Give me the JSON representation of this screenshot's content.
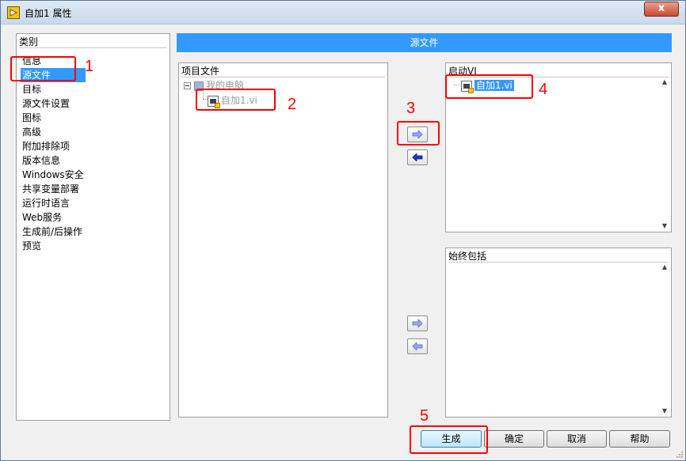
{
  "window": {
    "title": "自加1 属性",
    "close_glyph": "x"
  },
  "sidebar": {
    "header": "类别",
    "items": [
      {
        "label": "信息",
        "selected": false
      },
      {
        "label": "源文件",
        "selected": true
      },
      {
        "label": "目标",
        "selected": false
      },
      {
        "label": "源文件设置",
        "selected": false
      },
      {
        "label": "图标",
        "selected": false
      },
      {
        "label": "高级",
        "selected": false
      },
      {
        "label": "附加排除项",
        "selected": false
      },
      {
        "label": "版本信息",
        "selected": false
      },
      {
        "label": "Windows安全",
        "selected": false
      },
      {
        "label": "共享变量部署",
        "selected": false
      },
      {
        "label": "运行时语言",
        "selected": false
      },
      {
        "label": "Web服务",
        "selected": false
      },
      {
        "label": "生成前/后操作",
        "selected": false
      },
      {
        "label": "预览",
        "selected": false
      }
    ]
  },
  "section_title": "源文件",
  "project_files": {
    "header": "项目文件",
    "root_label": "我的电脑",
    "child_label": "自加1.vi"
  },
  "startup_vi": {
    "header": "启动VI",
    "item_label": "自加1.vi"
  },
  "always_include": {
    "header": "始终包括"
  },
  "buttons": {
    "build": "生成",
    "ok": "确定",
    "cancel": "取消",
    "help": "帮助"
  },
  "annotations": [
    "1",
    "2",
    "3",
    "4",
    "5"
  ],
  "colors": {
    "selection": "#3399ff",
    "annotation": "#ff0000"
  }
}
